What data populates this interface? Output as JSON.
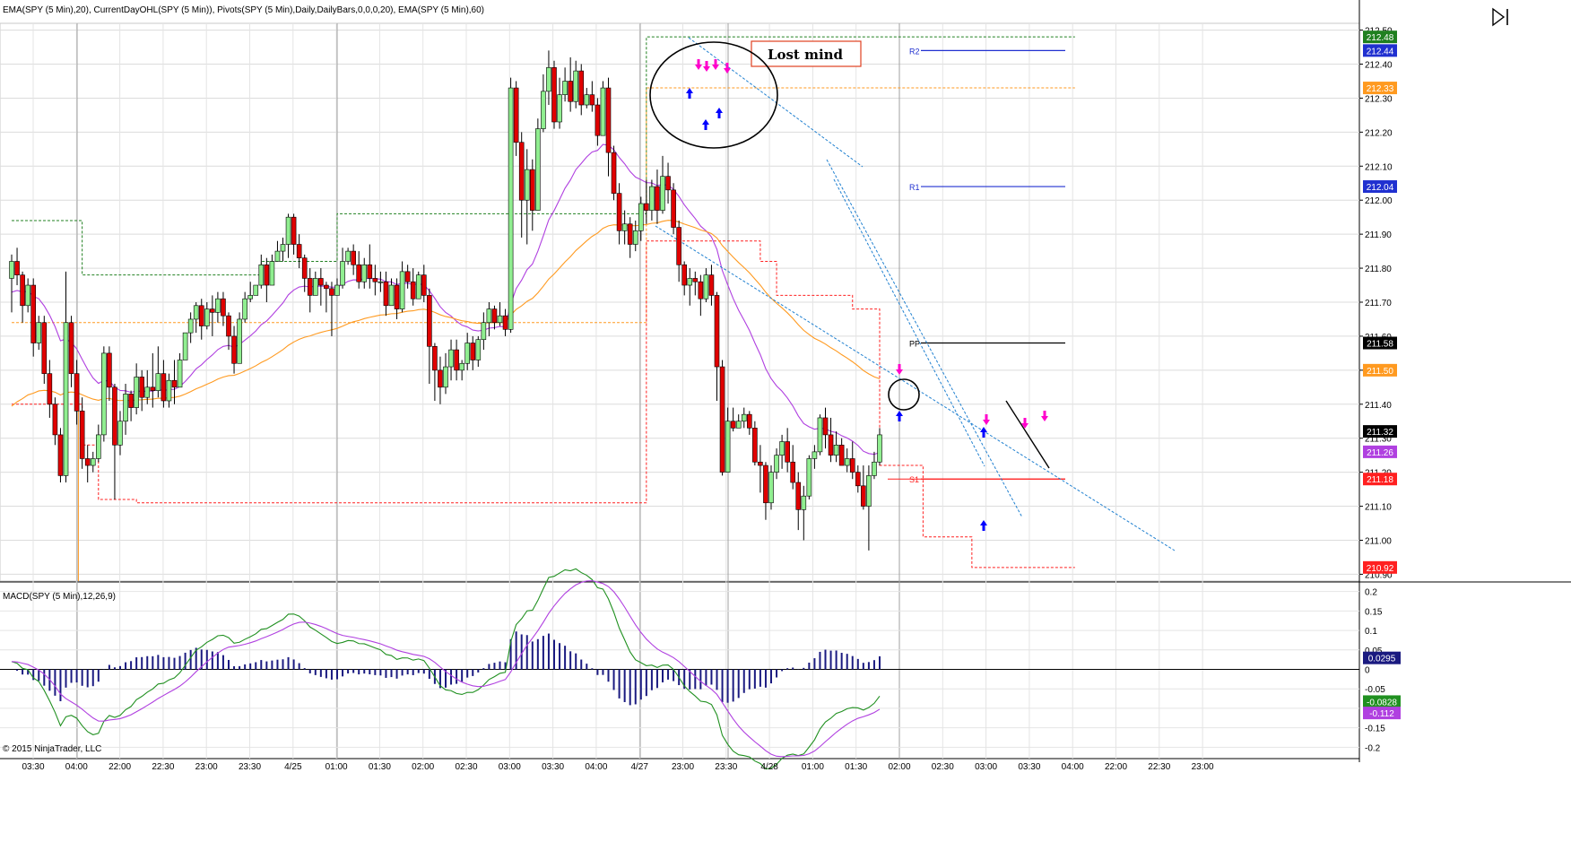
{
  "header": {
    "indicators": "EMA(SPY (5 Min),20), CurrentDayOHL(SPY (5 Min)), Pivots(SPY (5 Min),Daily,DailyBars,0,0,0,20), EMA(SPY (5 Min),60)"
  },
  "macd_label": "MACD(SPY (5 Min),12,26,9)",
  "copyright": "© 2015 NinjaTrader, LLC",
  "annotation": {
    "text": "Lost mind"
  },
  "colors": {
    "up_candle": "#90ee90",
    "down_candle": "#e00000",
    "ema20": "#b040e0",
    "ema60": "#ff9a20",
    "ohl_high": "#208020",
    "ohl_low": "#ff2020",
    "ohl_open": "#ff9a20",
    "pivot_r": "#2030d0",
    "pivot_pp": "#000000",
    "pivot_s": "#ff2020",
    "macd": "#209020",
    "macd_avg": "#b040e0",
    "macd_hist": "#1a1a80",
    "trendline": "#2080d0",
    "buy_arrow": "#0000ff",
    "sell_arrow": "#ff00cc"
  },
  "chart_data": {
    "type": "candlestick",
    "price_axis": {
      "ticks": [
        "212.50",
        "212.40",
        "212.30",
        "212.20",
        "212.10",
        "212.00",
        "211.90",
        "211.80",
        "211.70",
        "211.60",
        "211.50",
        "211.40",
        "211.30",
        "211.20",
        "211.10",
        "211.00",
        "210.90"
      ],
      "range": [
        210.88,
        212.52
      ]
    },
    "time_axis": {
      "ticks": [
        "03:30",
        "04:00",
        "22:00",
        "22:30",
        "23:00",
        "23:30",
        "4/25",
        "01:00",
        "01:30",
        "02:00",
        "02:30",
        "03:00",
        "03:30",
        "04:00",
        "4/27",
        "23:00",
        "23:30",
        "4/28",
        "01:00",
        "01:30",
        "02:00",
        "02:30",
        "03:00",
        "03:30",
        "04:00",
        "22:00",
        "22:30",
        "23:00"
      ]
    },
    "price_badges": [
      {
        "label": "212.48",
        "color": "#208020",
        "value": 212.48
      },
      {
        "label": "212.44",
        "color": "#2030d0",
        "value": 212.44
      },
      {
        "label": "212.33",
        "color": "#ff9a20",
        "value": 212.33
      },
      {
        "label": "212.04",
        "color": "#2030d0",
        "value": 212.04
      },
      {
        "label": "211.58",
        "color": "#000000",
        "value": 211.58
      },
      {
        "label": "211.50",
        "color": "#ff9a20",
        "value": 211.5
      },
      {
        "label": "211.32",
        "color": "#000000",
        "value": 211.32
      },
      {
        "label": "211.26",
        "color": "#b040e0",
        "value": 211.26
      },
      {
        "label": "211.18",
        "color": "#ff2020",
        "value": 211.18
      },
      {
        "label": "210.92",
        "color": "#ff2020",
        "value": 210.92
      }
    ],
    "pivots": [
      {
        "label": "R2",
        "value": 212.44
      },
      {
        "label": "R1",
        "value": 212.04
      },
      {
        "label": "PP",
        "value": 211.58
      },
      {
        "label": "S1",
        "value": 211.18
      }
    ],
    "candles": [
      [
        211.77,
        211.82,
        211.67,
        211.84
      ],
      [
        211.82,
        211.78,
        211.75,
        211.86
      ],
      [
        211.78,
        211.69,
        211.64,
        211.79
      ],
      [
        211.69,
        211.75,
        211.67,
        211.77
      ],
      [
        211.75,
        211.58,
        211.54,
        211.77
      ],
      [
        211.58,
        211.64,
        211.56,
        211.66
      ],
      [
        211.64,
        211.49,
        211.46,
        211.66
      ],
      [
        211.49,
        211.4,
        211.36,
        211.53
      ],
      [
        211.4,
        211.31,
        211.28,
        211.42
      ],
      [
        211.31,
        211.19,
        211.17,
        211.33
      ],
      [
        211.19,
        211.64,
        211.17,
        211.79
      ],
      [
        211.64,
        211.49,
        211.45,
        211.66
      ],
      [
        211.49,
        211.38,
        211.34,
        211.53
      ],
      [
        211.38,
        211.24,
        211.21,
        211.42
      ],
      [
        211.24,
        211.22,
        211.17,
        211.28
      ],
      [
        211.22,
        211.24,
        211.2,
        211.26
      ],
      [
        211.24,
        211.31,
        211.23,
        211.34
      ],
      [
        211.31,
        211.55,
        211.29,
        211.57
      ],
      [
        211.55,
        211.45,
        211.41,
        211.57
      ],
      [
        211.45,
        211.28,
        211.12,
        211.46
      ],
      [
        211.28,
        211.35,
        211.25,
        211.38
      ],
      [
        211.35,
        211.43,
        211.31,
        211.46
      ],
      [
        211.43,
        211.39,
        211.35,
        211.44
      ],
      [
        211.39,
        211.48,
        211.37,
        211.52
      ],
      [
        211.48,
        211.42,
        211.38,
        211.5
      ],
      [
        211.42,
        211.45,
        211.4,
        211.5
      ],
      [
        211.45,
        211.44,
        211.39,
        211.55
      ],
      [
        211.44,
        211.49,
        211.42,
        211.57
      ],
      [
        211.49,
        211.41,
        211.39,
        211.53
      ],
      [
        211.41,
        211.47,
        211.39,
        211.49
      ],
      [
        211.47,
        211.45,
        211.4,
        211.53
      ],
      [
        211.45,
        211.53,
        211.45,
        211.55
      ],
      [
        211.53,
        211.61,
        211.53,
        211.61
      ],
      [
        211.61,
        211.65,
        211.58,
        211.67
      ],
      [
        211.65,
        211.69,
        211.61,
        211.7
      ],
      [
        211.69,
        211.63,
        211.59,
        211.71
      ],
      [
        211.63,
        211.68,
        211.62,
        211.7
      ],
      [
        211.68,
        211.67,
        211.6,
        211.72
      ],
      [
        211.67,
        211.71,
        211.64,
        211.73
      ],
      [
        211.71,
        211.66,
        211.63,
        211.73
      ],
      [
        211.66,
        211.6,
        211.56,
        211.67
      ],
      [
        211.6,
        211.52,
        211.49,
        211.63
      ],
      [
        211.52,
        211.65,
        211.52,
        211.67
      ],
      [
        211.65,
        211.71,
        211.64,
        211.73
      ],
      [
        211.71,
        211.72,
        211.7,
        211.76
      ],
      [
        211.72,
        211.75,
        211.72,
        211.75
      ],
      [
        211.75,
        211.81,
        211.74,
        211.84
      ],
      [
        211.81,
        211.75,
        211.7,
        211.83
      ],
      [
        211.75,
        211.82,
        211.75,
        211.84
      ],
      [
        211.82,
        211.85,
        211.82,
        211.88
      ],
      [
        211.85,
        211.87,
        211.82,
        211.89
      ],
      [
        211.87,
        211.95,
        211.83,
        211.96
      ],
      [
        211.95,
        211.87,
        211.84,
        211.96
      ],
      [
        211.87,
        211.83,
        211.8,
        211.9
      ],
      [
        211.83,
        211.77,
        211.73,
        211.84
      ],
      [
        211.77,
        211.72,
        211.67,
        211.8
      ],
      [
        211.72,
        211.77,
        211.72,
        211.79
      ],
      [
        211.77,
        211.75,
        211.69,
        211.8
      ],
      [
        211.75,
        211.74,
        211.67,
        211.76
      ],
      [
        211.74,
        211.72,
        211.6,
        211.76
      ],
      [
        211.72,
        211.75,
        211.73,
        211.77
      ],
      [
        211.75,
        211.82,
        211.74,
        211.86
      ],
      [
        211.82,
        211.85,
        211.81,
        211.86
      ],
      [
        211.85,
        211.81,
        211.78,
        211.87
      ],
      [
        211.81,
        211.76,
        211.74,
        211.85
      ],
      [
        211.76,
        211.81,
        211.74,
        211.83
      ],
      [
        211.81,
        211.77,
        211.74,
        211.87
      ],
      [
        211.77,
        211.76,
        211.72,
        211.81
      ],
      [
        211.76,
        211.76,
        211.73,
        211.79
      ],
      [
        211.76,
        211.69,
        211.66,
        211.79
      ],
      [
        211.69,
        211.75,
        211.7,
        211.77
      ],
      [
        211.75,
        211.68,
        211.65,
        211.77
      ],
      [
        211.68,
        211.79,
        211.67,
        211.82
      ],
      [
        211.79,
        211.76,
        211.74,
        211.81
      ],
      [
        211.76,
        211.71,
        211.69,
        211.8
      ],
      [
        211.71,
        211.78,
        211.72,
        211.79
      ],
      [
        211.78,
        211.72,
        211.7,
        211.81
      ],
      [
        211.72,
        211.57,
        211.46,
        211.74
      ],
      [
        211.57,
        211.5,
        211.41,
        211.58
      ],
      [
        211.5,
        211.45,
        211.4,
        211.54
      ],
      [
        211.45,
        211.51,
        211.43,
        211.55
      ],
      [
        211.51,
        211.56,
        211.47,
        211.59
      ],
      [
        211.56,
        211.5,
        211.47,
        211.59
      ],
      [
        211.5,
        211.52,
        211.47,
        211.53
      ],
      [
        211.52,
        211.58,
        211.5,
        211.61
      ],
      [
        211.58,
        211.53,
        211.5,
        211.6
      ],
      [
        211.53,
        211.59,
        211.51,
        211.6
      ],
      [
        211.59,
        211.64,
        211.56,
        211.67
      ],
      [
        211.64,
        211.68,
        211.6,
        211.7
      ],
      [
        211.68,
        211.64,
        211.62,
        211.69
      ],
      [
        211.64,
        211.66,
        211.63,
        211.7
      ],
      [
        211.66,
        211.62,
        211.6,
        211.68
      ],
      [
        211.62,
        212.33,
        211.61,
        212.36
      ],
      [
        212.33,
        212.17,
        212.13,
        212.35
      ],
      [
        212.17,
        212.0,
        211.89,
        212.2
      ],
      [
        212.0,
        212.09,
        211.87,
        212.15
      ],
      [
        212.09,
        211.97,
        211.91,
        212.12
      ],
      [
        211.97,
        212.21,
        211.97,
        212.24
      ],
      [
        212.21,
        212.32,
        212.2,
        212.37
      ],
      [
        212.32,
        212.39,
        212.28,
        212.44
      ],
      [
        212.39,
        212.23,
        212.21,
        212.41
      ],
      [
        212.23,
        212.31,
        212.21,
        212.36
      ],
      [
        212.31,
        212.35,
        212.29,
        212.39
      ],
      [
        212.35,
        212.29,
        212.26,
        212.42
      ],
      [
        212.29,
        212.38,
        212.27,
        212.41
      ],
      [
        212.38,
        212.28,
        212.25,
        212.4
      ],
      [
        212.28,
        212.31,
        212.27,
        212.33
      ],
      [
        212.31,
        212.28,
        212.26,
        212.35
      ],
      [
        212.28,
        212.19,
        212.16,
        212.3
      ],
      [
        212.19,
        212.33,
        212.2,
        212.35
      ],
      [
        212.33,
        212.14,
        212.07,
        212.36
      ],
      [
        212.14,
        212.02,
        212.0,
        212.16
      ],
      [
        212.02,
        211.91,
        211.87,
        212.05
      ],
      [
        211.91,
        211.93,
        211.87,
        211.97
      ],
      [
        211.93,
        211.87,
        211.83,
        211.95
      ],
      [
        211.87,
        211.91,
        211.85,
        211.94
      ],
      [
        211.91,
        211.99,
        211.88,
        212.01
      ],
      [
        211.99,
        211.97,
        211.93,
        212.06
      ],
      [
        211.97,
        212.04,
        211.94,
        212.06
      ],
      [
        212.04,
        211.97,
        211.93,
        212.09
      ],
      [
        211.97,
        212.07,
        211.96,
        212.13
      ],
      [
        212.07,
        212.03,
        211.99,
        212.11
      ],
      [
        212.03,
        211.92,
        211.9,
        212.05
      ],
      [
        211.92,
        211.81,
        211.76,
        211.94
      ],
      [
        211.81,
        211.75,
        211.72,
        211.82
      ],
      [
        211.75,
        211.77,
        211.69,
        211.8
      ],
      [
        211.77,
        211.76,
        211.72,
        211.79
      ],
      [
        211.76,
        211.71,
        211.66,
        211.78
      ],
      [
        211.71,
        211.78,
        211.7,
        211.8
      ],
      [
        211.78,
        211.72,
        211.69,
        211.81
      ],
      [
        211.72,
        211.51,
        211.41,
        211.73
      ],
      [
        211.51,
        211.2,
        211.19,
        211.53
      ],
      [
        211.2,
        211.35,
        211.24,
        211.39
      ],
      [
        211.35,
        211.33,
        211.32,
        211.39
      ],
      [
        211.33,
        211.35,
        211.34,
        211.37
      ],
      [
        211.35,
        211.37,
        211.33,
        211.39
      ],
      [
        211.37,
        211.33,
        211.31,
        211.38
      ],
      [
        211.33,
        211.23,
        211.22,
        211.35
      ],
      [
        211.23,
        211.22,
        211.14,
        211.28
      ],
      [
        211.22,
        211.11,
        211.06,
        211.23
      ],
      [
        211.11,
        211.2,
        211.09,
        211.22
      ],
      [
        211.2,
        211.25,
        211.18,
        211.27
      ],
      [
        211.25,
        211.29,
        211.21,
        211.31
      ],
      [
        211.29,
        211.23,
        211.2,
        211.33
      ],
      [
        211.23,
        211.17,
        211.15,
        211.28
      ],
      [
        211.17,
        211.09,
        211.03,
        211.2
      ],
      [
        211.09,
        211.13,
        211.0,
        211.16
      ],
      [
        211.13,
        211.24,
        211.12,
        211.25
      ],
      [
        211.24,
        211.26,
        211.21,
        211.28
      ],
      [
        211.26,
        211.36,
        211.25,
        211.37
      ],
      [
        211.36,
        211.31,
        211.27,
        211.39
      ],
      [
        211.31,
        211.25,
        211.23,
        211.36
      ],
      [
        211.25,
        211.28,
        211.23,
        211.32
      ],
      [
        211.28,
        211.22,
        211.22,
        211.3
      ],
      [
        211.22,
        211.24,
        211.2,
        211.27
      ],
      [
        211.24,
        211.2,
        211.18,
        211.29
      ],
      [
        211.2,
        211.16,
        211.14,
        211.22
      ],
      [
        211.16,
        211.1,
        211.09,
        211.22
      ],
      [
        211.1,
        211.19,
        210.97,
        211.22
      ],
      [
        211.19,
        211.23,
        211.18,
        211.26
      ],
      [
        211.23,
        211.31,
        211.22,
        211.33
      ]
    ],
    "macd": {
      "axis_ticks": [
        "0.2",
        "0.15",
        "0.1",
        "0.05",
        "0",
        "-0.05",
        "-0.1",
        "-0.15",
        "-0.2"
      ],
      "range": [
        -0.22,
        0.22
      ],
      "badges": [
        {
          "label": "0.0295",
          "color": "#1a1a80",
          "value": 0.0295
        },
        {
          "label": "-0.0828",
          "color": "#209020",
          "value": -0.0828
        },
        {
          "label": "-0.112",
          "color": "#b040e0",
          "value": -0.112
        }
      ]
    }
  }
}
